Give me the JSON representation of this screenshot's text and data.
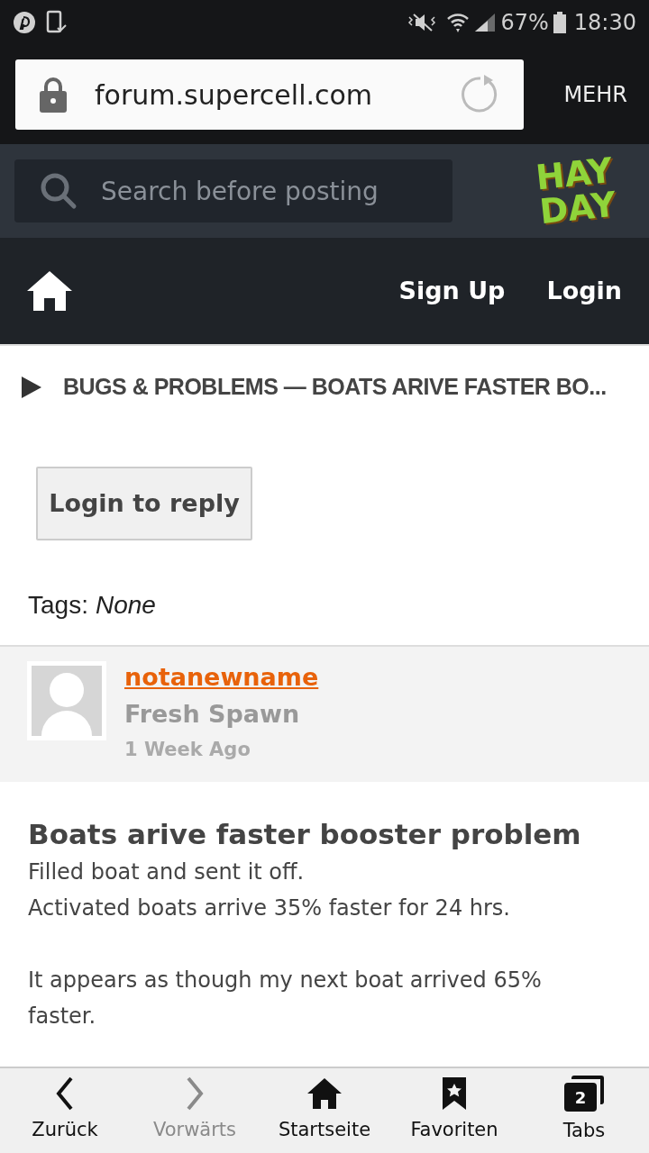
{
  "status_bar": {
    "battery": "67%",
    "time": "18:30"
  },
  "browser": {
    "url": "forum.supercell.com",
    "menu": "MEHR"
  },
  "header": {
    "search": {
      "placeholder": "Search before posting"
    },
    "logo_text": "HAY DAY"
  },
  "nav": {
    "links": [
      "Sign Up",
      "Login"
    ]
  },
  "breadcrumb": "BUGS & PROBLEMS — BOATS ARIVE FASTER BO...",
  "reply_button": "Login to reply",
  "tags": {
    "label": "Tags:",
    "value": "None"
  },
  "author": {
    "name": "notanewname",
    "rank": "Fresh Spawn",
    "time": "1 Week Ago"
  },
  "post": {
    "title": "Boats arive faster booster problem",
    "paragraphs": [
      [
        "Filled boat and sent it off.",
        "Activated boats arrive 35% faster for 24 hrs."
      ],
      [
        "It appears as though my next boat arrived 65% faster."
      ]
    ]
  },
  "bottom_bar": [
    {
      "kind": "back",
      "label": "Zurück",
      "disabled": false
    },
    {
      "kind": "forward",
      "label": "Vorwärts",
      "disabled": true
    },
    {
      "kind": "home",
      "label": "Startseite",
      "disabled": false
    },
    {
      "kind": "bookmarks",
      "label": "Favoriten",
      "disabled": false
    },
    {
      "kind": "tabs",
      "label": "Tabs",
      "count": "2",
      "disabled": false
    }
  ]
}
